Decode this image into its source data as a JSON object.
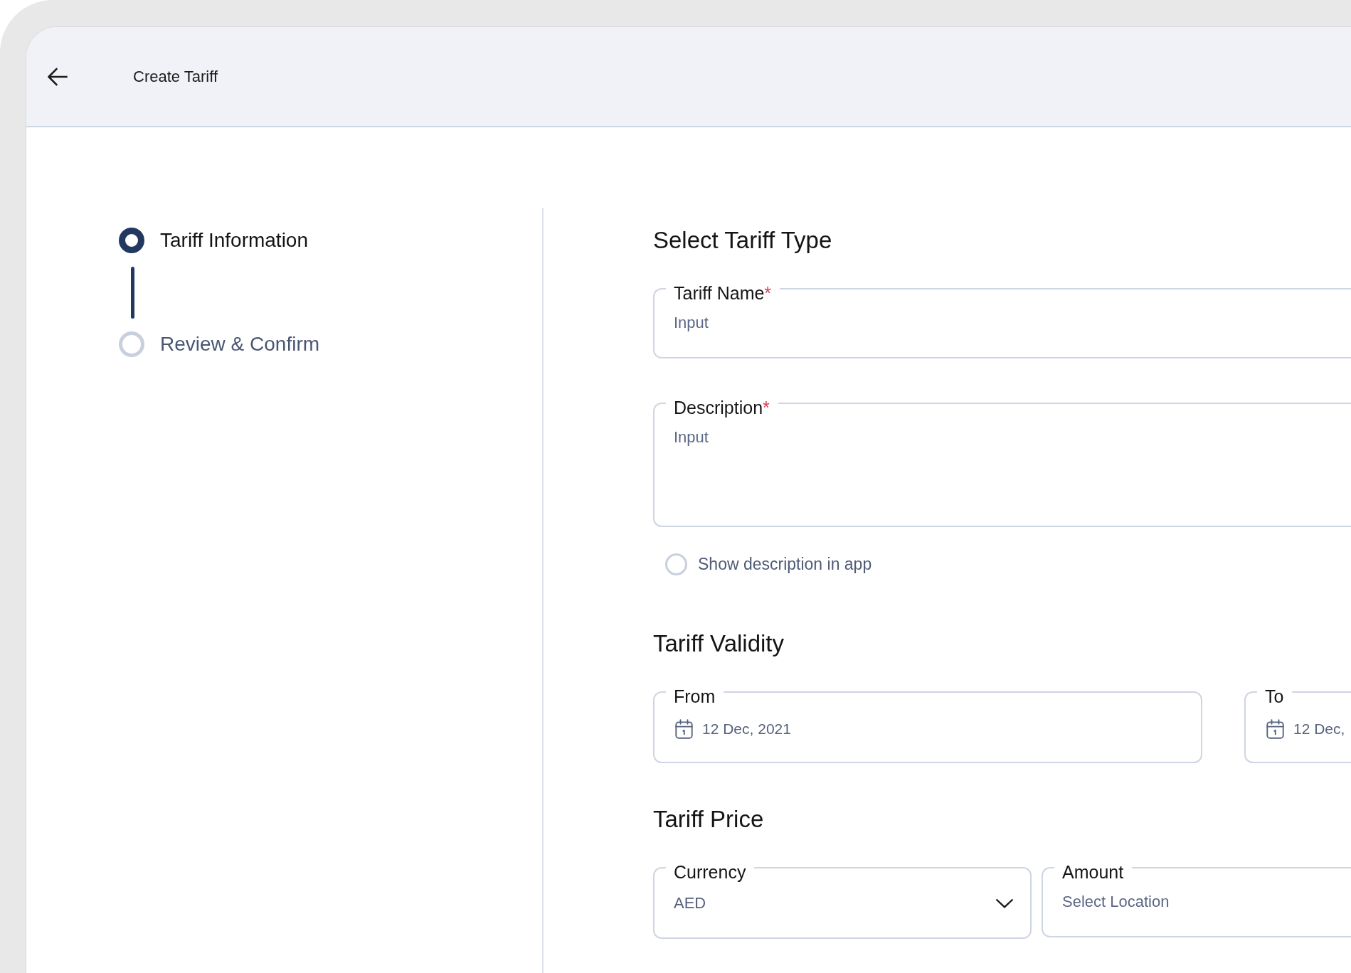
{
  "header": {
    "title": "Create Tariff"
  },
  "steps": [
    {
      "label": "Tariff Information",
      "selected": true
    },
    {
      "label": "Review & Confirm",
      "selected": false
    }
  ],
  "sections": [
    {
      "title": "Select Tariff Type",
      "rows": [
        {
          "fields": [
            {
              "kind": "text",
              "label": "Tariff Name",
              "required_mark": "*",
              "placeholder": "Input"
            }
          ]
        },
        {
          "fields": [
            {
              "kind": "textarea",
              "label": "Description",
              "required_mark": "*",
              "placeholder": "Input"
            }
          ]
        },
        {
          "fields": [
            {
              "kind": "checkbox",
              "label": "Show description in app",
              "checked": false
            }
          ]
        }
      ]
    },
    {
      "title": "Tariff Validity",
      "rows": [
        {
          "fields": [
            {
              "kind": "date",
              "label": "From",
              "value": "12 Dec, 2021"
            },
            {
              "kind": "date",
              "label": "To",
              "value": "12 Dec,"
            }
          ]
        }
      ]
    },
    {
      "title": "Tariff Price",
      "rows": [
        {
          "fields": [
            {
              "kind": "select",
              "label": "Currency",
              "value": "AED"
            },
            {
              "kind": "text",
              "label": "Amount",
              "placeholder": "Select Location"
            }
          ]
        }
      ]
    }
  ]
}
